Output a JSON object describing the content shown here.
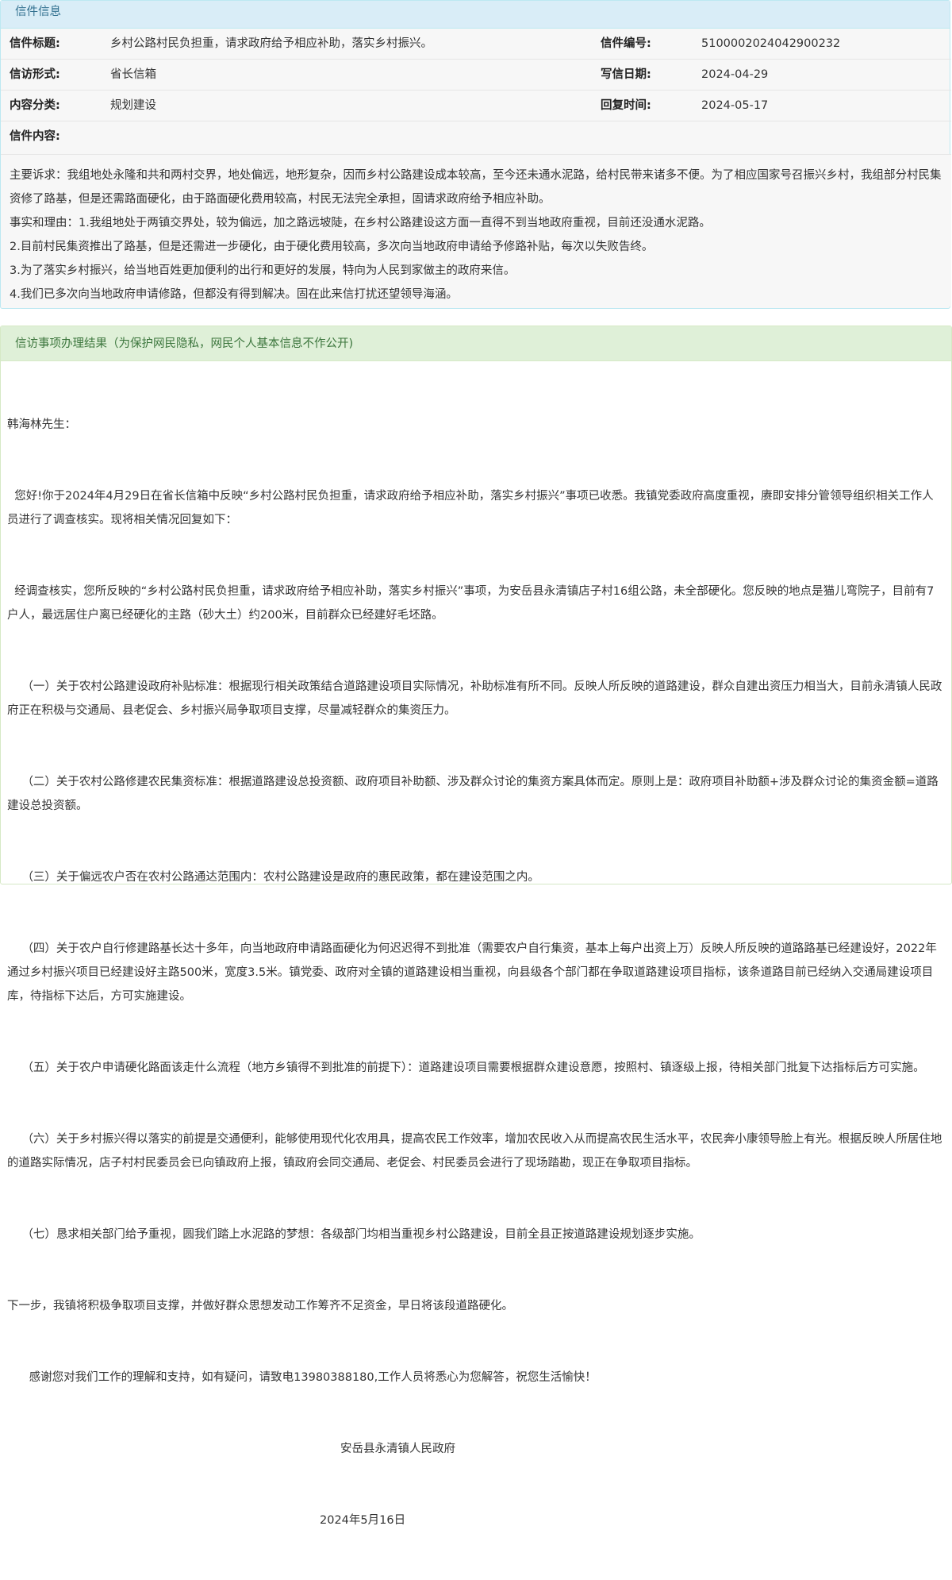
{
  "info": {
    "heading": "信件信息",
    "title_label": "信件标题:",
    "title_value": "乡村公路村民负担重，请求政府给予相应补助，落实乡村振兴。",
    "number_label": "信件编号:",
    "number_value": "510000202404290023​2",
    "form_label": "信访形式:",
    "form_value": "省长信箱",
    "date_label": "写信日期:",
    "date_value": "2024-04-29",
    "category_label": "内容分类:",
    "category_value": "规划建设",
    "reply_time_label": "回复时间:",
    "reply_time_value": "2024-05-17",
    "content_label": "信件内容:",
    "content": [
      "主要诉求：我组地处永隆和共和两村交界，地处偏远，地形复杂，因而乡村公路建设成本较高，至今还未通水泥路，给村民带来诸多不便。为了相应国家号召振兴乡村，我组部分村民集资修了路基，但是还需路面硬化，由于路面硬化费用较高，村民无法完全承担，固请求政府给予相应补助。",
      "事实和理由：1.我组地处于两镇交界处，较为偏远，加之路远坡陡，在乡村公路建设这方面一直得不到当地政府重视，目前还没通水泥路。",
      "2.目前村民集资推出了路基，但是还需进一步硬化，由于硬化费用较高，多次向当地政府申请给予修路补贴，每次以失败告终。",
      "3.为了落实乡村振兴，给当地百姓更加便利的出行和更好的发展，特向为人民到家做主的政府来信。",
      "4.我们已多次向当地政府申请修路，但都没有得到解决。固在此来信打扰还望领导海涵。"
    ]
  },
  "result": {
    "heading": "信访事项办理结果（为保护网民隐私，网民个人基本信息不作公开)",
    "paragraphs": [
      "韩海林先生：",
      "  您好!你于2024年4月29日在省长信箱中反映“乡村公路村民负担重，请求政府给予相应补助，落实乡村振兴”事项已收悉。我镇党委政府高度重视，赓即安排分管领导组织相关工作人员进行了调查核实。现将相关情况回复如下：",
      "  经调查核实，您所反映的“乡村公路村民负担重，请求政府给予相应补助，落实乡村振兴”事项，为安岳县永清镇店子村16组公路，未全部硬化。您反映的地点是猫儿弯院子，目前有7户人，最远居住户离已经硬化的主路（砂大土）约200米，目前群众已经建好毛坯路。",
      "    （一）关于农村公路建设政府补贴标准：根据现行相关政策结合道路建设项目实际情况，补助标准有所不同。反映人所反映的道路建设，群众自建出资压力相当大，目前永清镇人民政府正在积极与交通局、县老促会、乡村振兴局争取项目支撑，尽量减轻群众的集资压力。",
      "    （二）关于农村公路修建农民集资标准：根据道路建设总投资额、政府项目补助额、涉及群众讨论的集资方案具体而定。原则上是：政府项目补助额+涉及群众讨论的集资金额=道路建设总投资额。",
      "    （三）关于偏远农户否在农村公路通达范围内：农村公路建设是政府的惠民政策，都在建设范围之内。",
      "    （四）关于农户自行修建路基长达十多年，向当地政府申请路面硬化为何迟迟得不到批准（需要农户自行集资，基本上每户出资上万）反映人所反映的道路路基已经建设好，2022年通过乡村振兴项目已经建设好主路500米，宽度3.5米。镇党委、政府对全镇的道路建设相当重视，向县级各个部门都在争取道路建设项目指标，该条道路目前已经纳入交通局建设项目库，待指标下达后，方可实施建设。",
      "    （五）关于农户申请硬化路面该走什么流程（地方乡镇得不到批准的前提下）：道路建设项目需要根据群众建设意愿，按照村、镇逐级上报，待相关部门批复下达指标后方可实施。",
      "    （六）关于乡村振兴得以落实的前提是交通便利，能够使用现代化农用具，提高农民工作效率，增加农民收入从而提高农民生活水平，农民奔小康领导脸上有光。根据反映人所居住地的道路实际情况，店子村村民委员会已向镇政府上报，镇政府会同交通局、老促会、村民委员会进行了现场踏勘，现正在争取项目指标。",
      "    （七）恳求相关部门给予重视，圆我们踏上水泥路的梦想：各级部门均相当重视乡村公路建设，目前全县正按道路建设规划逐步实施。",
      "下一步，我镇将积极争取项目支撑，并做好群众思想发动工作筹齐不足资金，早日将该段道路硬化。",
      "      感谢您对我们工作的理解和支持，如有疑问，请致电13980388180,工作人员将悉心为您解答，祝您生活愉快！"
    ],
    "signature": "安岳县永清镇人民政府",
    "sign_date": "2024年5月16日"
  }
}
